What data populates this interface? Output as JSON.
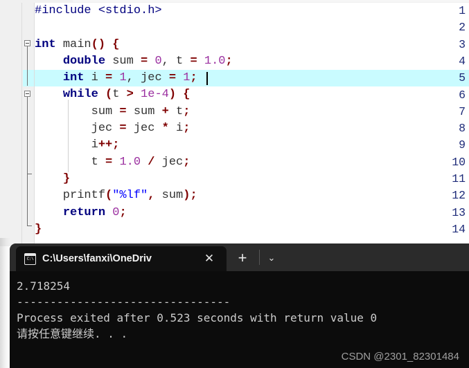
{
  "editor": {
    "gutter_numbers": [
      "1",
      "2",
      "3",
      "4",
      "5",
      "6",
      "7",
      "8",
      "9",
      "10",
      "11",
      "12",
      "13",
      "14"
    ],
    "lines": [
      {
        "n": "1",
        "tokens": [
          {
            "t": "#include <stdio.h>",
            "c": "pre"
          }
        ]
      },
      {
        "n": "2",
        "tokens": []
      },
      {
        "n": "3",
        "tokens": [
          {
            "t": "int",
            "c": "kw"
          },
          {
            "t": " ",
            "c": "id"
          },
          {
            "t": "main",
            "c": "id"
          },
          {
            "t": "()",
            "c": "op"
          },
          {
            "t": " ",
            "c": "id"
          },
          {
            "t": "{",
            "c": "brc"
          }
        ]
      },
      {
        "n": "4",
        "tokens": [
          {
            "t": "    ",
            "c": "id"
          },
          {
            "t": "double",
            "c": "kw"
          },
          {
            "t": " sum ",
            "c": "id"
          },
          {
            "t": "=",
            "c": "op"
          },
          {
            "t": " ",
            "c": "id"
          },
          {
            "t": "0",
            "c": "num"
          },
          {
            "t": ", t ",
            "c": "id"
          },
          {
            "t": "=",
            "c": "op"
          },
          {
            "t": " ",
            "c": "id"
          },
          {
            "t": "1.0",
            "c": "num"
          },
          {
            "t": ";",
            "c": "op"
          }
        ]
      },
      {
        "n": "5",
        "tokens": [
          {
            "t": "    ",
            "c": "id"
          },
          {
            "t": "int",
            "c": "kw"
          },
          {
            "t": " i ",
            "c": "id"
          },
          {
            "t": "=",
            "c": "op"
          },
          {
            "t": " ",
            "c": "id"
          },
          {
            "t": "1",
            "c": "num"
          },
          {
            "t": ", jec ",
            "c": "id"
          },
          {
            "t": "=",
            "c": "op"
          },
          {
            "t": " ",
            "c": "id"
          },
          {
            "t": "1",
            "c": "num"
          },
          {
            "t": ";",
            "c": "op"
          }
        ]
      },
      {
        "n": "6",
        "tokens": [
          {
            "t": "    ",
            "c": "id"
          },
          {
            "t": "while",
            "c": "kw"
          },
          {
            "t": " ",
            "c": "id"
          },
          {
            "t": "(",
            "c": "op"
          },
          {
            "t": "t ",
            "c": "id"
          },
          {
            "t": ">",
            "c": "op"
          },
          {
            "t": " ",
            "c": "id"
          },
          {
            "t": "1e-4",
            "c": "num"
          },
          {
            "t": ")",
            "c": "op"
          },
          {
            "t": " ",
            "c": "id"
          },
          {
            "t": "{",
            "c": "brc"
          }
        ]
      },
      {
        "n": "7",
        "tokens": [
          {
            "t": "        sum ",
            "c": "id"
          },
          {
            "t": "=",
            "c": "op"
          },
          {
            "t": " sum ",
            "c": "id"
          },
          {
            "t": "+",
            "c": "op"
          },
          {
            "t": " t",
            "c": "id"
          },
          {
            "t": ";",
            "c": "op"
          }
        ]
      },
      {
        "n": "8",
        "tokens": [
          {
            "t": "        jec ",
            "c": "id"
          },
          {
            "t": "=",
            "c": "op"
          },
          {
            "t": " jec ",
            "c": "id"
          },
          {
            "t": "*",
            "c": "op"
          },
          {
            "t": " i",
            "c": "id"
          },
          {
            "t": ";",
            "c": "op"
          }
        ]
      },
      {
        "n": "9",
        "tokens": [
          {
            "t": "        i",
            "c": "id"
          },
          {
            "t": "++;",
            "c": "op"
          }
        ]
      },
      {
        "n": "10",
        "tokens": [
          {
            "t": "        t ",
            "c": "id"
          },
          {
            "t": "=",
            "c": "op"
          },
          {
            "t": " ",
            "c": "id"
          },
          {
            "t": "1.0",
            "c": "num"
          },
          {
            "t": " ",
            "c": "id"
          },
          {
            "t": "/",
            "c": "op"
          },
          {
            "t": " jec",
            "c": "id"
          },
          {
            "t": ";",
            "c": "op"
          }
        ]
      },
      {
        "n": "11",
        "tokens": [
          {
            "t": "    ",
            "c": "id"
          },
          {
            "t": "}",
            "c": "brc"
          }
        ]
      },
      {
        "n": "12",
        "tokens": [
          {
            "t": "    printf",
            "c": "id"
          },
          {
            "t": "(",
            "c": "op"
          },
          {
            "t": "\"%lf\"",
            "c": "str"
          },
          {
            "t": ",",
            "c": "op"
          },
          {
            "t": " sum",
            "c": "id"
          },
          {
            "t": ")",
            "c": "op"
          },
          {
            "t": ";",
            "c": "op"
          }
        ]
      },
      {
        "n": "13",
        "tokens": [
          {
            "t": "    ",
            "c": "id"
          },
          {
            "t": "return",
            "c": "kw"
          },
          {
            "t": " ",
            "c": "id"
          },
          {
            "t": "0",
            "c": "num"
          },
          {
            "t": ";",
            "c": "op"
          }
        ]
      },
      {
        "n": "14",
        "tokens": [
          {
            "t": "}",
            "c": "brc"
          }
        ]
      }
    ],
    "active_line": 5,
    "fold_markers": [
      3,
      6
    ],
    "colors": {
      "highlight": "#c9fbff",
      "gutter_bg": "#f0f0f0",
      "lineno": "#1d2a78",
      "keyword": "#00007f",
      "operator": "#7f0000",
      "number": "#9b30a0",
      "string": "#0000ff"
    }
  },
  "terminal": {
    "tab": {
      "icon": "cmd-console-icon",
      "icon_text": "C:\\",
      "title": "C:\\Users\\fanxi\\OneDriv",
      "close_label": "✕"
    },
    "new_tab_label": "+",
    "dropdown_label": "⌄",
    "output": [
      "2.718254",
      "--------------------------------",
      "Process exited after 0.523 seconds with return value 0",
      "请按任意键继续. . ."
    ],
    "background": "#0c0c0c",
    "tabbar_background": "#2b2b2b"
  },
  "watermark": {
    "text": "CSDN @2301_82301484"
  }
}
